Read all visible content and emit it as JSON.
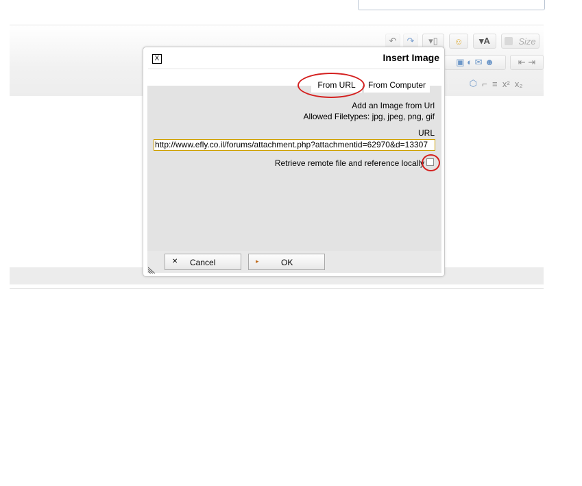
{
  "toolbar": {
    "size_placeholder": "Size",
    "undo_icon": "undo-icon",
    "redo_icon": "redo-icon",
    "paste_icon": "paste-icon",
    "smiley_icon": "smiley-icon",
    "font_color_icon": "font-color-icon",
    "superscript_label": "x²",
    "subscript_label": "x₂"
  },
  "dialog": {
    "title": "Insert Image",
    "close_label": "X",
    "tabs": [
      {
        "label": "From URL",
        "selected": true
      },
      {
        "label": "From Computer",
        "selected": false
      }
    ],
    "heading": "Add an Image from Url",
    "filetypes": "Allowed Filetypes: jpg, jpeg, png, gif",
    "url_label": "URL",
    "url_value": "http://www.efly.co.il/forums/attachment.php?attachmentid=62970&d=13307",
    "retrieve_label": "Retrieve remote file and reference locally",
    "retrieve_checked": false,
    "cancel_label": "Cancel",
    "ok_label": "OK"
  },
  "annotation_color": "#d4201f"
}
